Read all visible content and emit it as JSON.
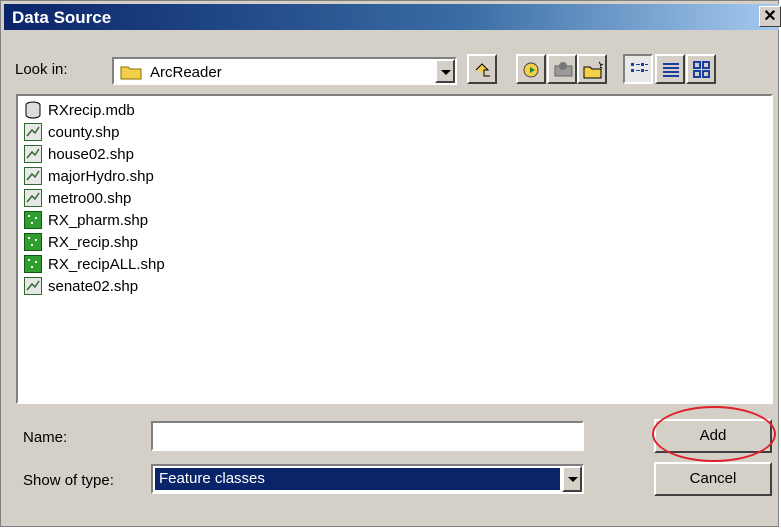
{
  "window": {
    "title": "Data Source",
    "close_glyph": "✕"
  },
  "lookin": {
    "label": "Look in:",
    "value": "ArcReader"
  },
  "toolbar": {
    "icons": [
      "up-folder-icon",
      "connect-folder-icon",
      "disconnect-folder-icon",
      "new-folder-icon",
      "list-view-icon",
      "details-view-icon",
      "thumbnails-view-icon"
    ]
  },
  "files": [
    {
      "name": "RXrecip.mdb",
      "icon": "database-icon"
    },
    {
      "name": "county.shp",
      "icon": "line-shapefile-icon"
    },
    {
      "name": "house02.shp",
      "icon": "line-shapefile-icon"
    },
    {
      "name": "majorHydro.shp",
      "icon": "line-shapefile-icon"
    },
    {
      "name": "metro00.shp",
      "icon": "line-shapefile-icon"
    },
    {
      "name": "RX_pharm.shp",
      "icon": "point-shapefile-icon"
    },
    {
      "name": "RX_recip.shp",
      "icon": "point-shapefile-icon"
    },
    {
      "name": "RX_recipALL.shp",
      "icon": "point-shapefile-icon"
    },
    {
      "name": "senate02.shp",
      "icon": "line-shapefile-icon"
    }
  ],
  "name_field": {
    "label": "Name:",
    "value": ""
  },
  "type_field": {
    "label": "Show of type:",
    "value": "Feature classes"
  },
  "buttons": {
    "add": "Add",
    "cancel": "Cancel"
  },
  "colors": {
    "title_bar": "#0a246a",
    "selection": "#0a246a",
    "highlight_circle": "#e0202a"
  }
}
